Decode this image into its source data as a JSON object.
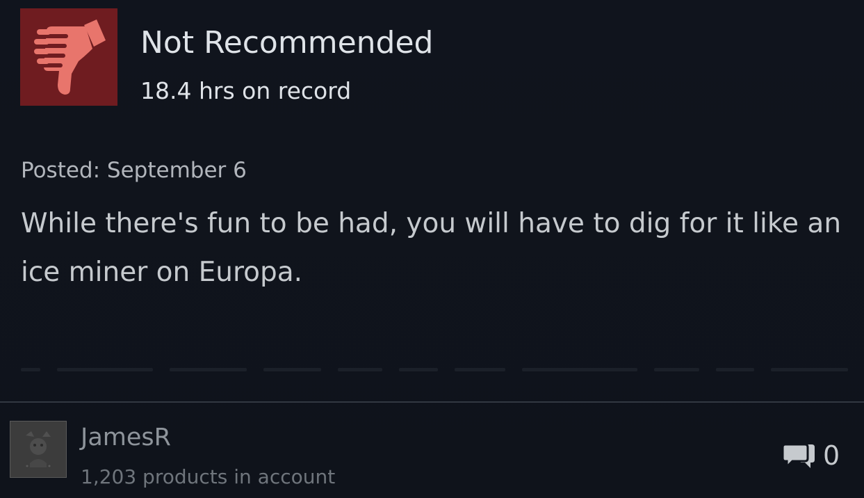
{
  "review": {
    "verdict": "Not Recommended",
    "verdict_icon": "thumbs-down-icon",
    "hours": "18.4 hrs on record",
    "posted": "Posted: September 6",
    "body": "While there's fun to be had, you will have to dig for it like an ice miner on Europa."
  },
  "author": {
    "name": "JamesR",
    "products": "1,203 products in account"
  },
  "comments": {
    "icon": "comment-bubbles-icon",
    "count": "0"
  },
  "colors": {
    "background": "#0f121a",
    "verdict_box": "#6f1c20",
    "thumb": "#e8756c",
    "divider": "#323842"
  }
}
